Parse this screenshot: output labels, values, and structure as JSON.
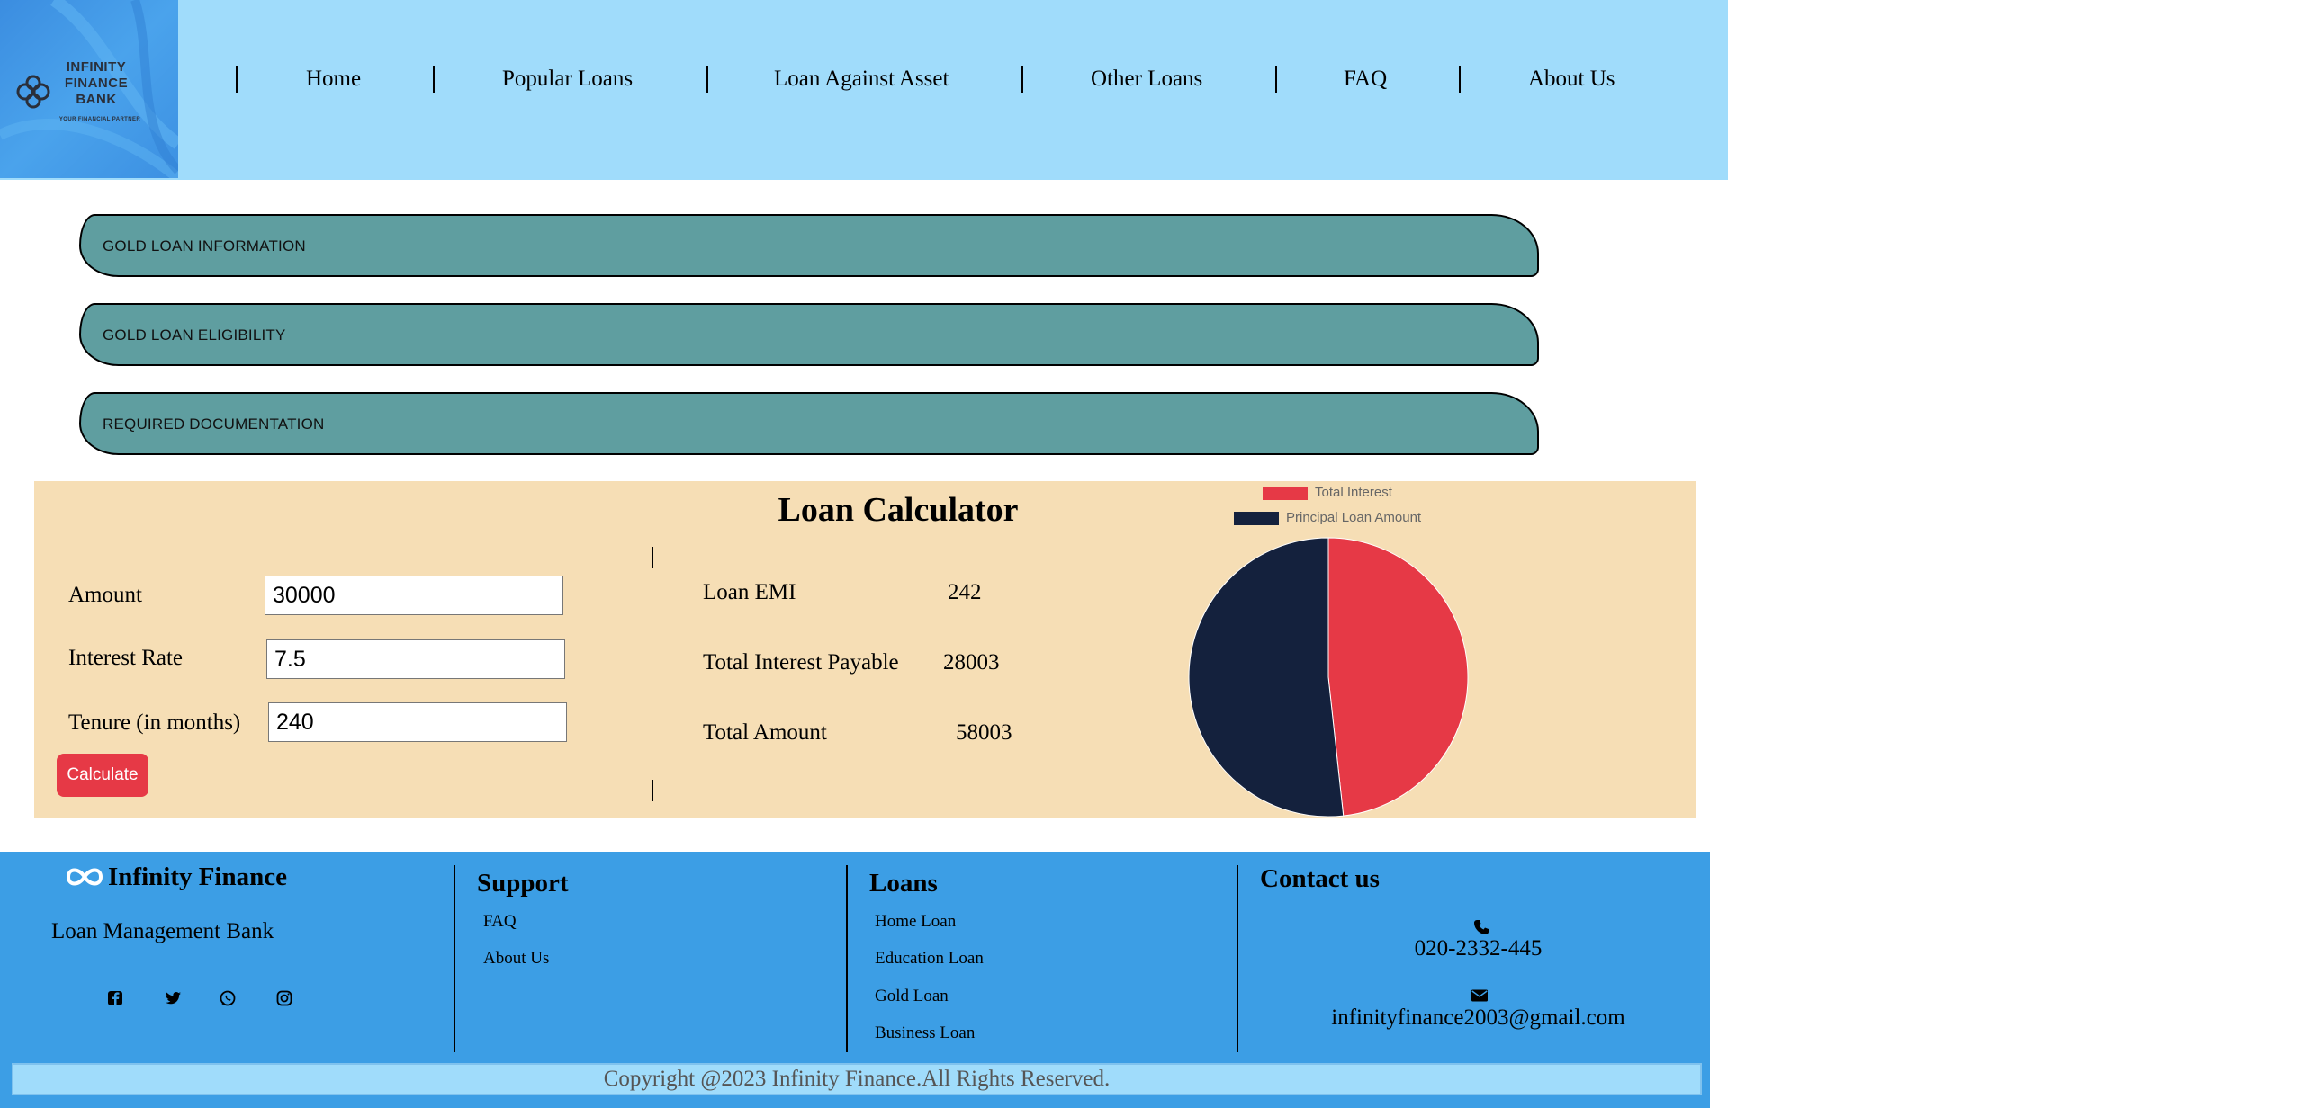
{
  "header": {
    "logo_lines": [
      "INFINITY",
      "FINANCE",
      "BANK"
    ],
    "logo_tagline": "YOUR FINANCIAL PARTNER",
    "nav": [
      "Home",
      "Popular Loans",
      "Loan Against Asset",
      "Other Loans",
      "FAQ",
      "About Us"
    ]
  },
  "accordions": [
    "GOLD LOAN INFORMATION",
    "GOLD LOAN ELIGIBILITY",
    "REQUIRED DOCUMENTATION"
  ],
  "calculator": {
    "title": "Loan Calculator",
    "amount_label": "Amount",
    "amount_value": "30000",
    "rate_label": "Interest Rate",
    "rate_value": "7.5",
    "tenure_label": "Tenure (in months)",
    "tenure_value": "240",
    "button_label": "Calculate",
    "results": [
      {
        "label": "Loan EMI",
        "value": "242"
      },
      {
        "label": "Total Interest Payable",
        "value": "28003"
      },
      {
        "label": "Total Amount",
        "value": "58003"
      }
    ]
  },
  "chart_data": {
    "type": "pie",
    "series": [
      {
        "name": "Total Interest",
        "value": 28003,
        "color": "#e63946"
      },
      {
        "name": "Principal Loan Amount",
        "value": 30000,
        "color": "#14213d"
      }
    ],
    "legend_position": "top"
  },
  "footer": {
    "brand": "Infinity Finance",
    "subtitle": "Loan Management Bank",
    "support_heading": "Support",
    "support_links": [
      "FAQ",
      "About Us"
    ],
    "loans_heading": "Loans",
    "loan_links": [
      "Home Loan",
      "Education Loan",
      "Gold Loan",
      "Business Loan"
    ],
    "contact_heading": "Contact us",
    "phone": "020-2332-445",
    "email": "infinityfinance2003@gmail.com",
    "copyright": "Copyright @2023 Infinity Finance.All Rights Reserved."
  }
}
